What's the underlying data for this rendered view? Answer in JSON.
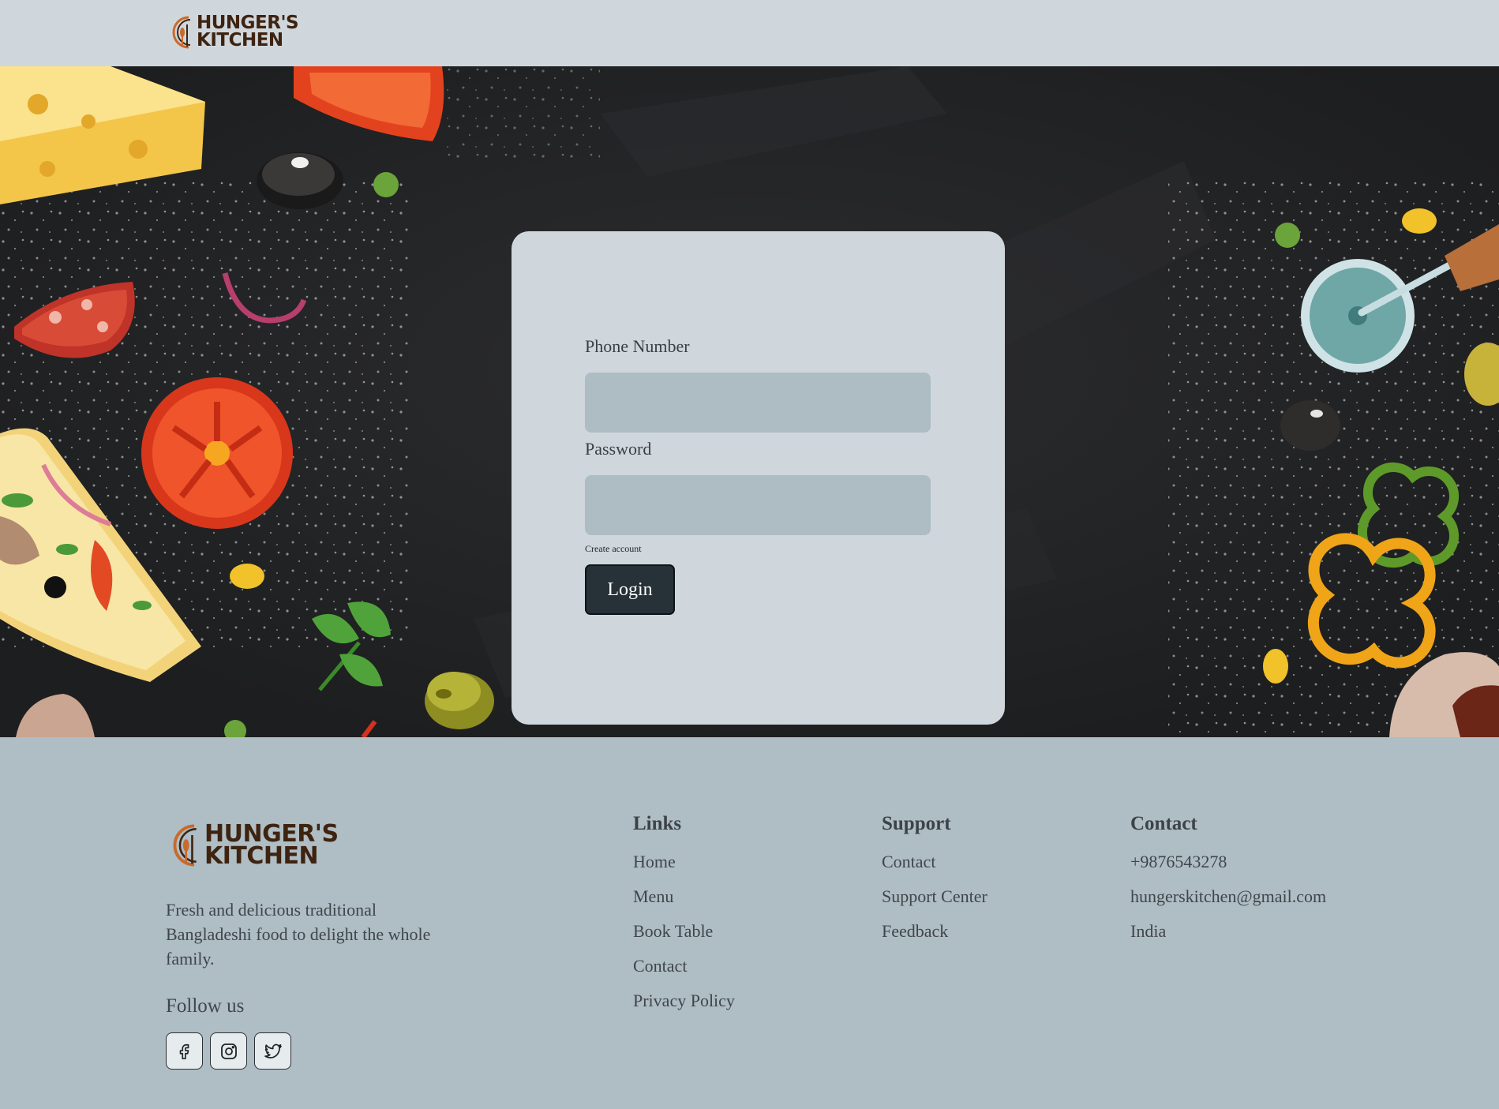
{
  "brand": {
    "line1": "HUNGER'S",
    "line2": "KITCHEN",
    "logo_icon": "fork-spoon-plate-icon"
  },
  "login": {
    "phone_label": "Phone Number",
    "phone_value": "",
    "password_label": "Password",
    "password_value": "",
    "create_account": "Create account",
    "login_button": "Login"
  },
  "footer": {
    "about": "Fresh and delicious traditional Bangladeshi food to delight the whole family.",
    "follow_us": "Follow us",
    "socials": [
      {
        "icon": "facebook-icon"
      },
      {
        "icon": "instagram-icon"
      },
      {
        "icon": "twitter-icon"
      }
    ],
    "links": {
      "title": "Links",
      "items": [
        "Home",
        "Menu",
        "Book Table",
        "Contact",
        "Privacy Policy"
      ]
    },
    "support": {
      "title": "Support",
      "items": [
        "Contact",
        "Support Center",
        "Feedback"
      ]
    },
    "contact": {
      "title": "Contact",
      "items": [
        "+9876543278",
        "hungerskitchen@gmail.com",
        "India"
      ]
    }
  },
  "colors": {
    "header_bg": "#cfd7dd",
    "hero_bg": "#232425",
    "card_bg": "#cfd7dd",
    "input_bg": "#aebcc3",
    "button_bg": "#263238",
    "footer_bg": "#afbdc4",
    "brand_brown": "#3e2310",
    "brand_orange": "#c86a2c"
  }
}
